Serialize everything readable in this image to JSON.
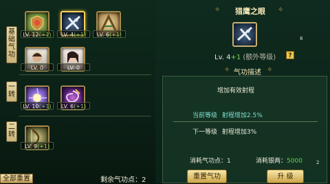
{
  "categories": [
    {
      "name": "基础气功",
      "chars": [
        "基",
        "础",
        "气",
        "功"
      ]
    },
    {
      "name": "一转",
      "chars": [
        "一",
        "转"
      ]
    },
    {
      "name": "二转",
      "chars": [
        "二",
        "转"
      ]
    }
  ],
  "skills": [
    {
      "id": "s1",
      "level": "LV. 12",
      "bonus": "(+1)",
      "icon": "shield-crest-icon"
    },
    {
      "id": "s2",
      "level": "LV. 4",
      "bonus": "(+1)",
      "icon": "hawk-eye-icon",
      "selected": true
    },
    {
      "id": "s3",
      "level": "LV. 6",
      "bonus": "(+1)",
      "icon": "golden-claw-icon"
    },
    {
      "id": "s4",
      "level": "LV. 0",
      "bonus": "",
      "icon": "warrior-portrait-icon"
    },
    {
      "id": "s5",
      "level": "LV. 0",
      "bonus": "",
      "icon": "archer-portrait-icon"
    },
    {
      "id": "s6",
      "level": "LV. 10",
      "bonus": "(+1)",
      "icon": "lightning-orb-icon"
    },
    {
      "id": "s7",
      "level": "LV. 6",
      "bonus": "(+1)",
      "icon": "purple-whirl-icon"
    },
    {
      "id": "s8",
      "level": "LV. 9",
      "bonus": "(+1)",
      "icon": "bow-rune-icon"
    }
  ],
  "footer": {
    "reset_label": "全部重置",
    "points_label": "剩余气功点：2"
  },
  "detail": {
    "title": "猎鹰之眼",
    "level_text": "Lv. 4",
    "level_bonus": "+1",
    "level_extra": "(额外等级)",
    "help_label": "?",
    "desc_header": "气功描述",
    "effect": "增加有效射程",
    "current_label": "当前等级",
    "current_effect": "射程增加2.5%",
    "next_label": "下一等级",
    "next_effect": "射程增加3%",
    "cost_points_label": "消耗气功点：1",
    "cost_silver_label": "消耗银两：",
    "cost_silver_value": "5000",
    "btn_left_label": "重置气功",
    "btn_upgrade_label": "升 级",
    "edge_mark_1": "8",
    "edge_mark_2": "2"
  },
  "colors": {
    "bonus": "#7ad65a",
    "current": "#7fe0d0",
    "silver": "#6ad24a",
    "frame": "#a88a4c",
    "selected": "#f5d25a"
  }
}
